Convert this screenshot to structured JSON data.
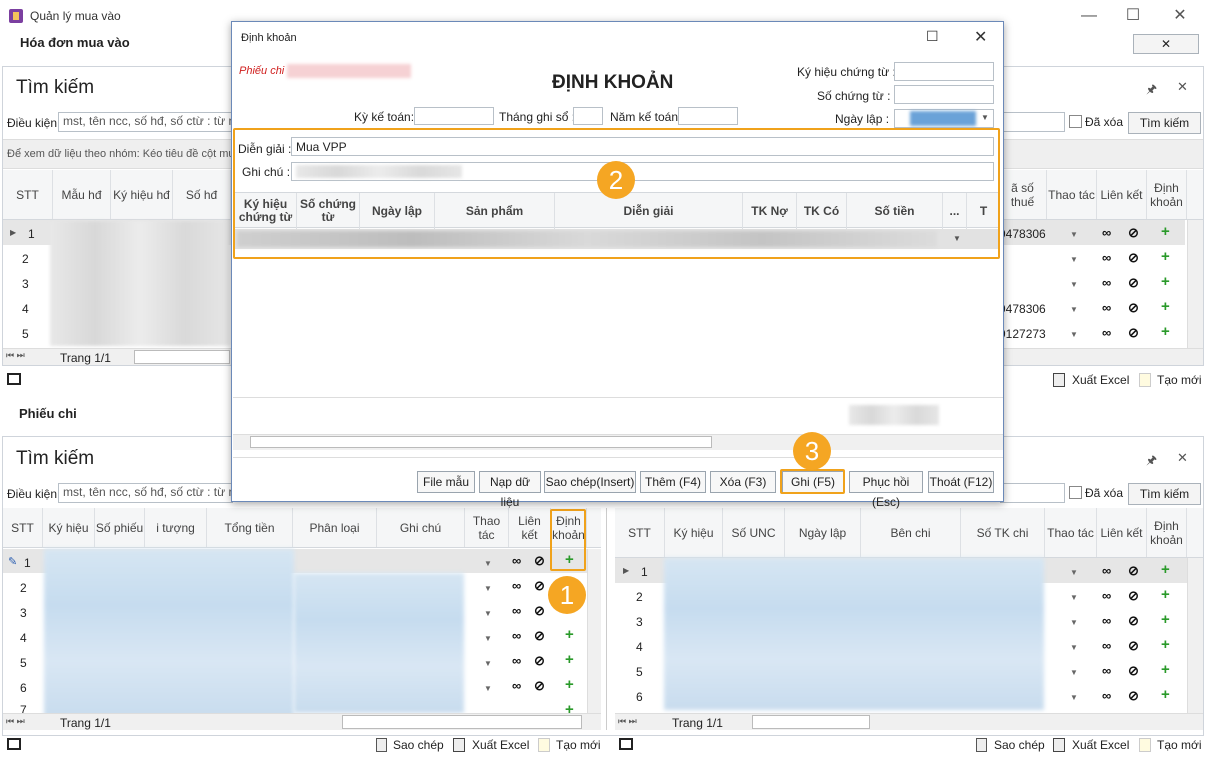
{
  "window": {
    "title": "Quản lý mua vào",
    "controls": [
      "—",
      "☐",
      "✕"
    ]
  },
  "top_section": {
    "title": "Hóa đơn mua vào",
    "close": "✕"
  },
  "search_top": {
    "title": "Tìm kiếm",
    "cond_label": "Điều kiện:",
    "cond_placeholder": "mst, tên ncc, số hđ, số ctừ : từ ngà",
    "group_hint": "Để xem dữ liệu theo nhóm: Kéo tiêu đề cột mu",
    "deleted_label": "Đã xóa",
    "search_btn": "Tìm kiếm",
    "pin": "🖈",
    "close": "✕"
  },
  "top_grid": {
    "headers": [
      "STT",
      "Mẫu hđ",
      "Ký hiệu hđ",
      "Số hđ"
    ],
    "right_headers": [
      "ã số thuế",
      "Thao tác",
      "Liên kết",
      "Định khoản"
    ],
    "rows": [
      "1",
      "2",
      "3",
      "4",
      "5"
    ],
    "tax_values": [
      "9478306",
      "",
      "",
      "9478306",
      "9127273"
    ],
    "pager": "Trang 1/1"
  },
  "top_footer": {
    "export": "Xuất Excel",
    "create": "Tạo mới"
  },
  "mid_section": {
    "title": "Phiếu chi"
  },
  "search_bottom": {
    "title": "Tìm kiếm",
    "cond_label": "Điều kiện:",
    "cond_placeholder": "mst, tên ncc, số hđ, số ctừ : từ ngà",
    "deleted_label": "Đã xóa",
    "search_btn": "Tìm kiếm",
    "pin": "🖈",
    "close": "✕"
  },
  "left_grid": {
    "headers": [
      "STT",
      "Ký hiệu",
      "Số phiếu",
      "i tượng",
      "Tổng tiền",
      "Phân loại",
      "Ghi chú",
      "Thao tác",
      "Liên kết",
      "Định khoản"
    ],
    "rows": [
      "1",
      "2",
      "3",
      "4",
      "5",
      "6",
      "7"
    ],
    "pager": "Trang 1/1"
  },
  "right_grid": {
    "headers": [
      "STT",
      "Ký hiệu",
      "Số UNC",
      "Ngày lập",
      "Bên chi",
      "Số TK chi",
      "Thao tác",
      "Liên kết",
      "Định khoản"
    ],
    "rows": [
      "1",
      "2",
      "3",
      "4",
      "5",
      "6"
    ],
    "pager": "Trang 1/1"
  },
  "bottom_footer_left": {
    "copy": "Sao chép",
    "export": "Xuất Excel",
    "create": "Tạo mới"
  },
  "bottom_footer_right": {
    "copy": "Sao chép",
    "export": "Xuất Excel",
    "create": "Tạo mới"
  },
  "dialog": {
    "title": "Định khoản",
    "heading": "ĐỊNH KHOẢN",
    "voucher_label": "Phiếu chi",
    "ky_hieu_label": "Ký hiệu chứng từ :",
    "so_ct_label": "Số chứng từ :",
    "ngay_lap_label": "Ngày lập :",
    "ky_ke_toan_label": "Kỳ kế toán:",
    "thang_ghi_so_label": "Tháng ghi sổ :",
    "nam_ke_toan_label": "Năm kế toán :",
    "dien_giai_label": "Diễn giải :",
    "dien_giai_value": "Mua VPP",
    "ghi_chu_label": "Ghi chú :",
    "grid_headers": [
      "Ký hiệu chứng từ",
      "Số chứng từ",
      "Ngày lập",
      "Sản phẩm",
      "Diễn giải",
      "TK Nợ",
      "TK Có",
      "Số tiền",
      "...",
      "T"
    ],
    "buttons": [
      "File mẫu",
      "Nạp dữ liệu",
      "Sao chép(Insert)",
      "Thêm (F4)",
      "Xóa (F3)",
      "Ghi (F5)",
      "Phục hồi (Esc)",
      "Thoát (F12)"
    ],
    "max": "☐",
    "close": "✕"
  },
  "badges": [
    "1",
    "2",
    "3"
  ]
}
